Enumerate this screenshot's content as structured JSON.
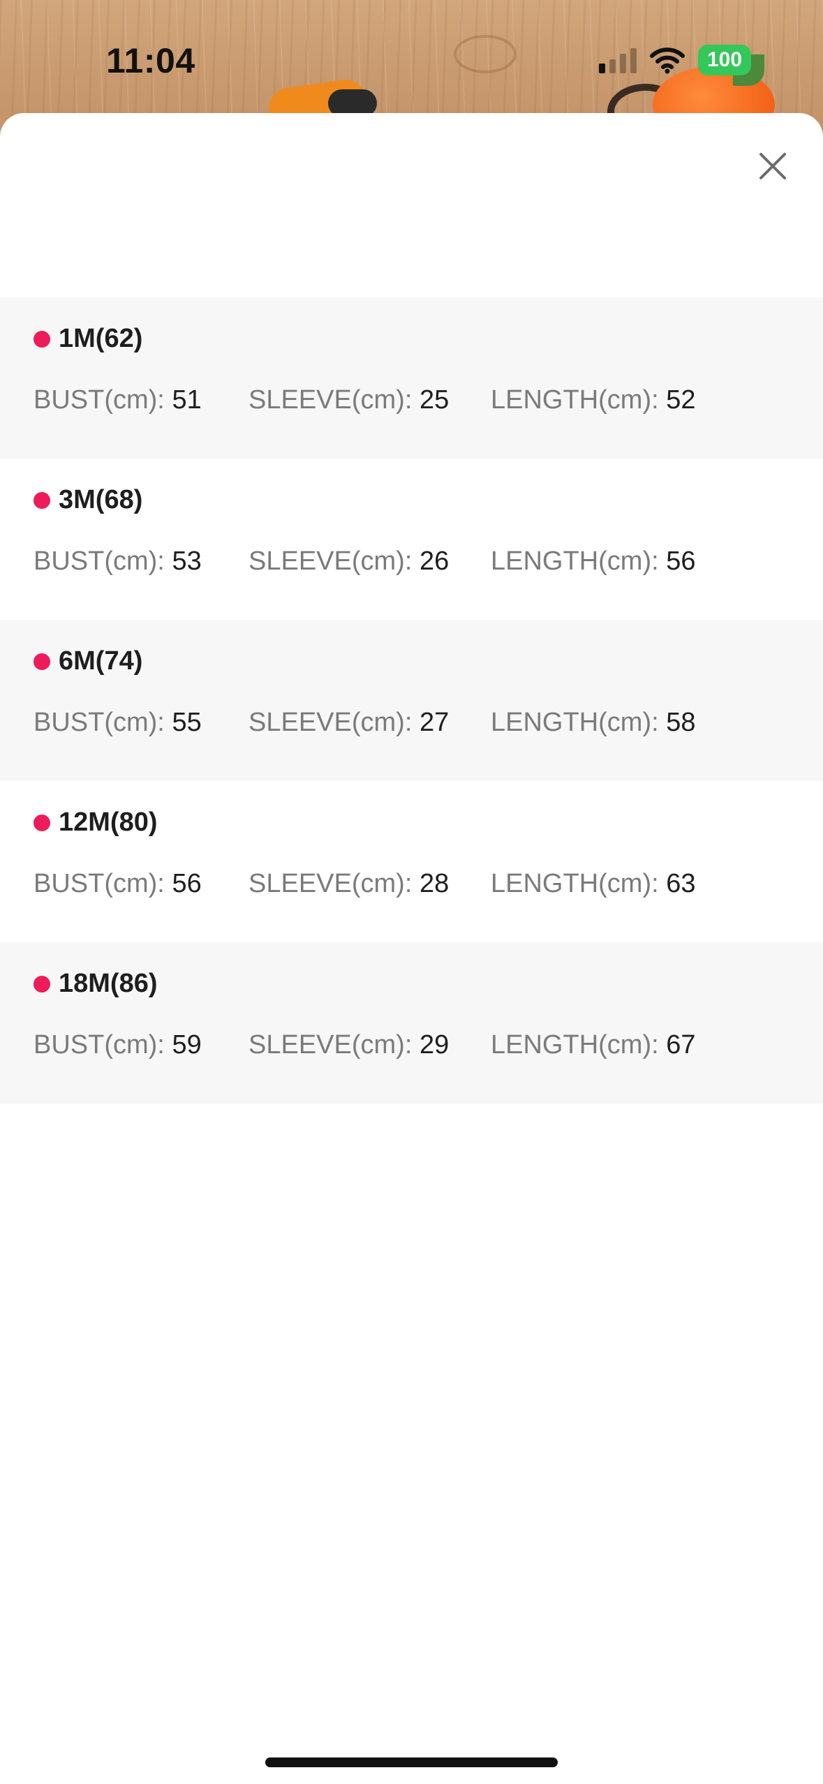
{
  "status_bar": {
    "time": "11:04",
    "battery": "100",
    "icons": [
      "signal-icon",
      "wifi-icon",
      "battery-icon"
    ]
  },
  "sheet": {
    "close_icon": "close-icon"
  },
  "sizes": [
    {
      "name": "1M(62)",
      "bust_label": "BUST(cm): ",
      "bust": "51",
      "sleeve_label": "SLEEVE(cm): ",
      "sleeve": "25",
      "length_label": "LENGTH(cm): ",
      "length": "52"
    },
    {
      "name": "3M(68)",
      "bust_label": "BUST(cm): ",
      "bust": "53",
      "sleeve_label": "SLEEVE(cm): ",
      "sleeve": "26",
      "length_label": "LENGTH(cm): ",
      "length": "56"
    },
    {
      "name": "6M(74)",
      "bust_label": "BUST(cm): ",
      "bust": "55",
      "sleeve_label": "SLEEVE(cm): ",
      "sleeve": "27",
      "length_label": "LENGTH(cm): ",
      "length": "58"
    },
    {
      "name": "12M(80)",
      "bust_label": "BUST(cm): ",
      "bust": "56",
      "sleeve_label": "SLEEVE(cm): ",
      "sleeve": "28",
      "length_label": "LENGTH(cm): ",
      "length": "63"
    },
    {
      "name": "18M(86)",
      "bust_label": "BUST(cm): ",
      "bust": "59",
      "sleeve_label": "SLEEVE(cm): ",
      "sleeve": "29",
      "length_label": "LENGTH(cm): ",
      "length": "67"
    }
  ],
  "colors": {
    "dot": "#ee1b5a",
    "battery": "#34c759",
    "row_shade": "#f7f7f7"
  }
}
